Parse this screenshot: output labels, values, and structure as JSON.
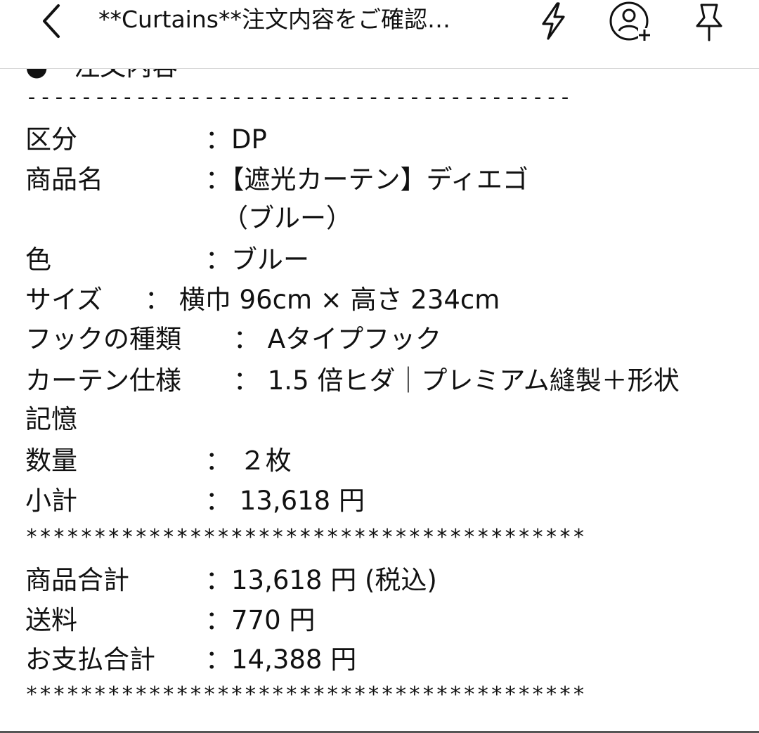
{
  "header": {
    "title": "**Curtains**注文内容をご確認…",
    "icons": [
      "chevron-left-icon",
      "lightning-bolt-icon",
      "add-user-icon",
      "pin-icon"
    ]
  },
  "partial_line": "●・注文内容",
  "separator_dashes": "----------------------------------------",
  "separator_stars": "*****************************************",
  "order": {
    "category_label": "区分",
    "category_value": "：DP",
    "product_label": "商品名",
    "product_value_1": "：【遮光カーテン】ディエゴ",
    "product_value_2": "（ブルー）",
    "color_label": "色",
    "color_value": "：ブルー",
    "size_label": "サイズ",
    "size_value": "： 横巾 96cm × 高さ 234cm",
    "hook_label": "フックの種類",
    "hook_value": "： Aタイプフック",
    "spec_label": "カーテン仕様",
    "spec_value": "： 1.5 倍ヒダ｜プレミアム縫製＋形状",
    "spec_value_cont": "記憶",
    "qty_label": "数量",
    "qty_value": "： ２枚",
    "subtotal_label": "小計",
    "subtotal_value": "： 13,618 円"
  },
  "totals": {
    "goods_total_label": "商品合計",
    "goods_total_value": "：13,618 円 (税込)",
    "shipping_label": "送料",
    "shipping_value": "：770 円",
    "payment_total_label": "お支払合計",
    "payment_total_value": "：14,388 円"
  }
}
